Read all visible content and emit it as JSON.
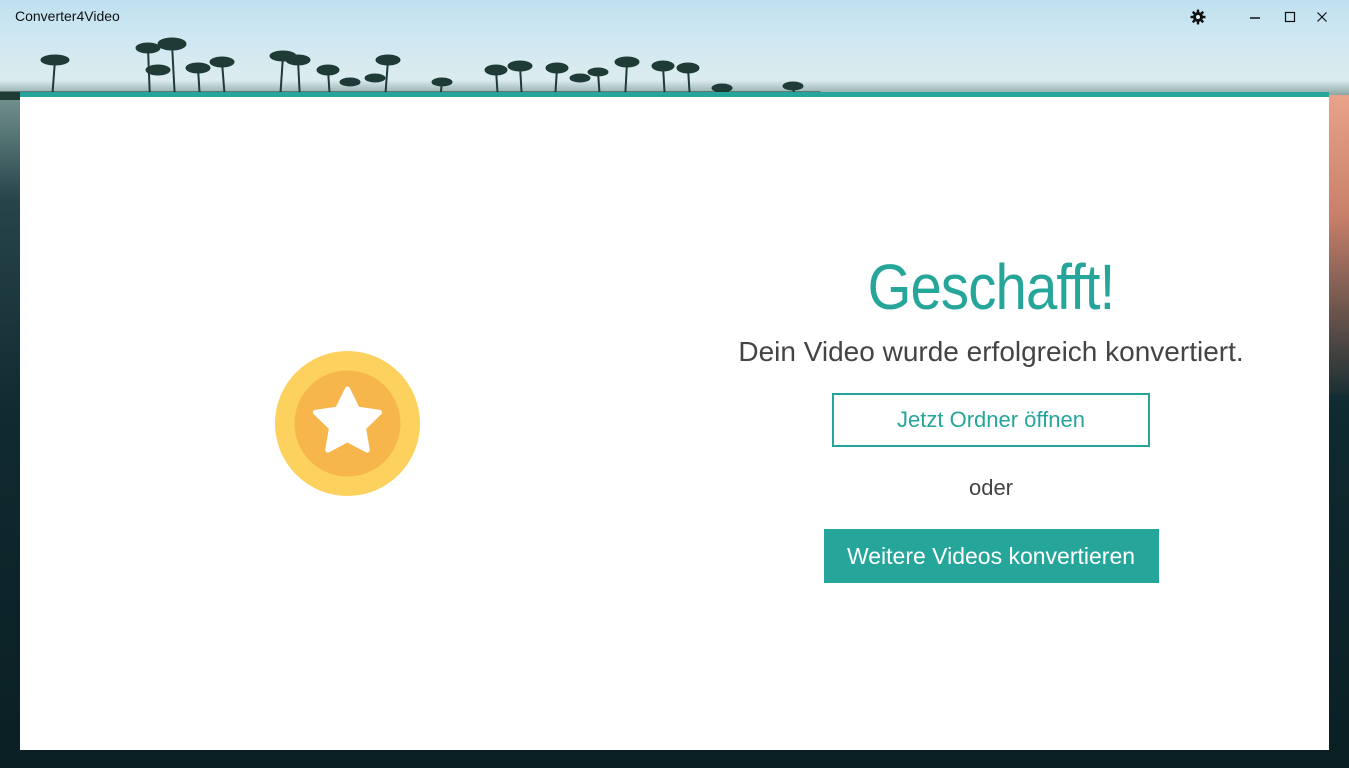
{
  "app": {
    "title": "Converter4Video"
  },
  "window_controls": {
    "settings_icon": "gear-icon",
    "minimize_icon": "minimize-icon",
    "maximize_icon": "maximize-icon",
    "close_icon": "close-icon"
  },
  "success": {
    "icon": "star-medal-icon",
    "headline": "Geschafft!",
    "message": "Dein Video wurde erfolgreich konvertiert.",
    "open_folder_label": "Jetzt Ordner öffnen",
    "or_label": "oder",
    "convert_more_label": "Weitere Videos konvertieren"
  },
  "colors": {
    "accent": "#26a69a",
    "medal_outer": "#fdd15e",
    "medal_inner": "#f6b64c",
    "text": "#444444"
  }
}
